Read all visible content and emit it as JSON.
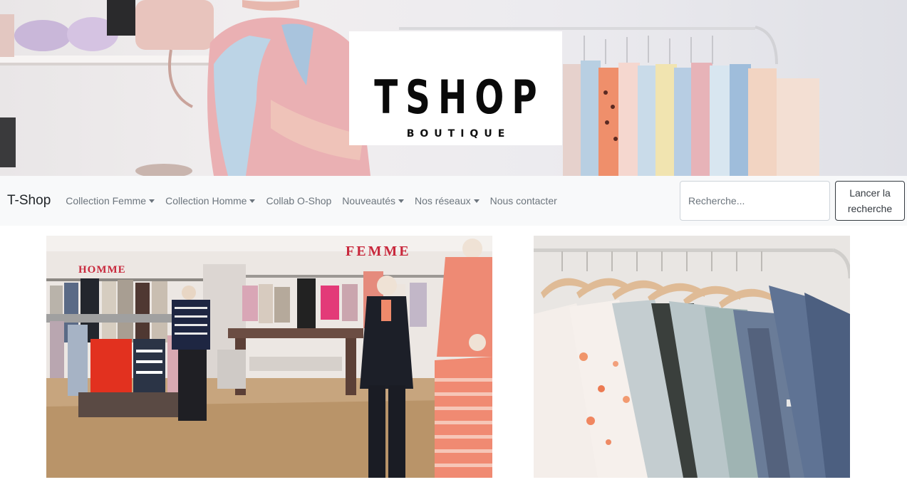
{
  "hero": {
    "logo_title": "TSHOP",
    "logo_subtitle": "BOUTIQUE"
  },
  "navbar": {
    "brand": "T-Shop",
    "items": [
      {
        "label": "Collection Femme",
        "dropdown": true
      },
      {
        "label": "Collection Homme",
        "dropdown": true
      },
      {
        "label": "Collab O-Shop",
        "dropdown": false
      },
      {
        "label": "Nouveautés",
        "dropdown": true
      },
      {
        "label": "Nos réseaux",
        "dropdown": true
      },
      {
        "label": "Nous contacter",
        "dropdown": false
      }
    ],
    "search": {
      "placeholder": "Recherche...",
      "button_label": "Lancer la recherche"
    }
  },
  "store_photo": {
    "sign_homme": "HOMME",
    "sign_femme": "FEMME"
  },
  "colors": {
    "navbar_bg": "#f8f9fa",
    "nav_text": "#6c757d",
    "brand_text": "#212529",
    "button_border": "#343a40",
    "store_sign_red": "#c8283c"
  }
}
